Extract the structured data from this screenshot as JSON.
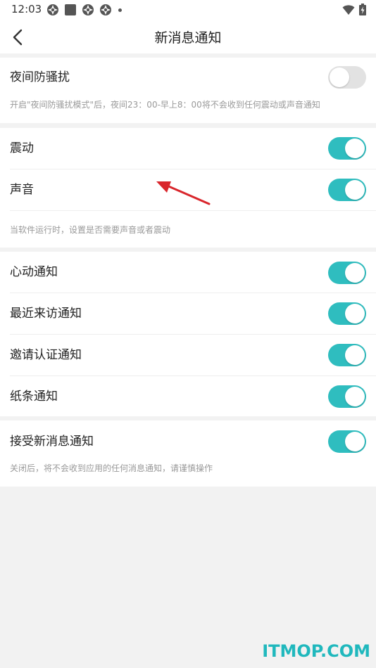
{
  "status_bar": {
    "time": "12:03"
  },
  "header": {
    "title": "新消息通知"
  },
  "night": {
    "label": "夜间防骚扰",
    "enabled": false,
    "hint": "开启\"夜间防骚扰模式\"后，夜间23：00-早上8：00将不会收到任何震动或声音通知"
  },
  "alerts": {
    "items": [
      {
        "label": "震动",
        "enabled": true
      },
      {
        "label": "声音",
        "enabled": true
      }
    ],
    "hint": "当软件运行时，设置是否需要声音或者震动"
  },
  "notifications": {
    "items": [
      {
        "label": "心动通知",
        "enabled": true
      },
      {
        "label": "最近来访通知",
        "enabled": true
      },
      {
        "label": "邀请认证通知",
        "enabled": true
      },
      {
        "label": "纸条通知",
        "enabled": true
      }
    ]
  },
  "receive": {
    "label": "接受新消息通知",
    "enabled": true,
    "hint": "关闭后，将不会收到应用的任何消息通知，请谨慎操作"
  },
  "watermark": "ITMOP.COM",
  "colors": {
    "toggle_on": "#2fbdbf",
    "toggle_off": "#e2e2e2",
    "annotation_arrow": "#d9262c",
    "watermark": "#20b8bd"
  }
}
